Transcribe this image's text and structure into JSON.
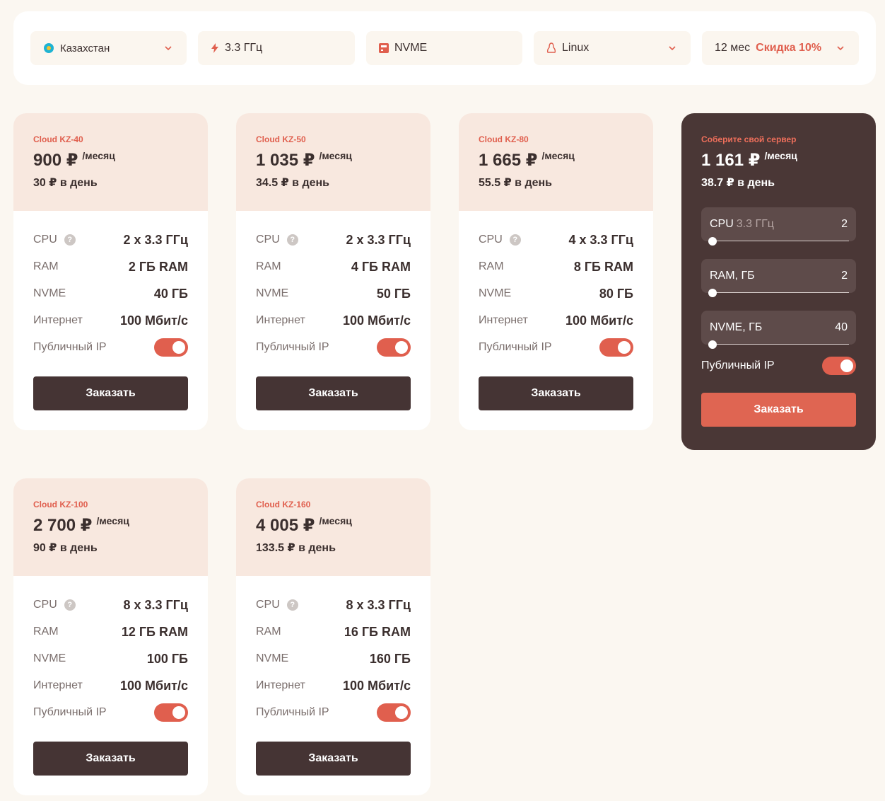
{
  "filters": {
    "location": {
      "label": "Казахстан",
      "icon": "kazakhstan-flag-icon"
    },
    "cpu": {
      "label": "3.3 ГГц",
      "icon": "lightning-icon"
    },
    "disk": {
      "label": "NVME",
      "icon": "disk-icon"
    },
    "os": {
      "label": "Linux",
      "icon": "linux-icon"
    },
    "period": {
      "label": "12 мес",
      "discount": "Скидка 10%"
    }
  },
  "labels": {
    "cpu": "CPU",
    "ram": "RAM",
    "nvme": "NVME",
    "internet": "Интернет",
    "public_ip": "Публичный IP",
    "order": "Заказать",
    "per_month": "/месяц"
  },
  "plans": [
    {
      "name": "Cloud KZ-40",
      "price": "900 ₽",
      "per_day": "30 ₽ в день",
      "cpu": "2 x 3.3 ГГц",
      "ram": "2 ГБ RAM",
      "nvme": "40 ГБ",
      "internet": "100 Мбит/с",
      "public_ip": true
    },
    {
      "name": "Cloud KZ-50",
      "price": "1 035 ₽",
      "per_day": "34.5 ₽ в день",
      "cpu": "2 x 3.3 ГГц",
      "ram": "4 ГБ RAM",
      "nvme": "50 ГБ",
      "internet": "100 Мбит/с",
      "public_ip": true
    },
    {
      "name": "Cloud KZ-80",
      "price": "1 665 ₽",
      "per_day": "55.5 ₽ в день",
      "cpu": "4 x 3.3 ГГц",
      "ram": "8 ГБ RAM",
      "nvme": "80 ГБ",
      "internet": "100 Мбит/с",
      "public_ip": true
    },
    {
      "name": "Cloud KZ-100",
      "price": "2 700 ₽",
      "per_day": "90 ₽ в день",
      "cpu": "8 x 3.3 ГГц",
      "ram": "12 ГБ RAM",
      "nvme": "100 ГБ",
      "internet": "100 Мбит/с",
      "public_ip": true
    },
    {
      "name": "Cloud KZ-160",
      "price": "4 005 ₽",
      "per_day": "133.5 ₽ в день",
      "cpu": "8 x 3.3 ГГц",
      "ram": "16 ГБ RAM",
      "nvme": "160 ГБ",
      "internet": "100 Мбит/с",
      "public_ip": true
    }
  ],
  "custom": {
    "title": "Соберите свой сервер",
    "price": "1 161 ₽",
    "per_day": "38.7 ₽ в день",
    "cpu_label": "CPU",
    "cpu_freq": "3.3 ГГц",
    "cpu_value": "2",
    "ram_label": "RAM, ГБ",
    "ram_value": "2",
    "nvme_label": "NVME, ГБ",
    "nvme_value": "40",
    "public_ip_label": "Публичный IP",
    "public_ip": true,
    "order": "Заказать"
  },
  "colors": {
    "accent": "#e05f4e",
    "dark": "#453434",
    "card_head": "#f8e8df"
  }
}
